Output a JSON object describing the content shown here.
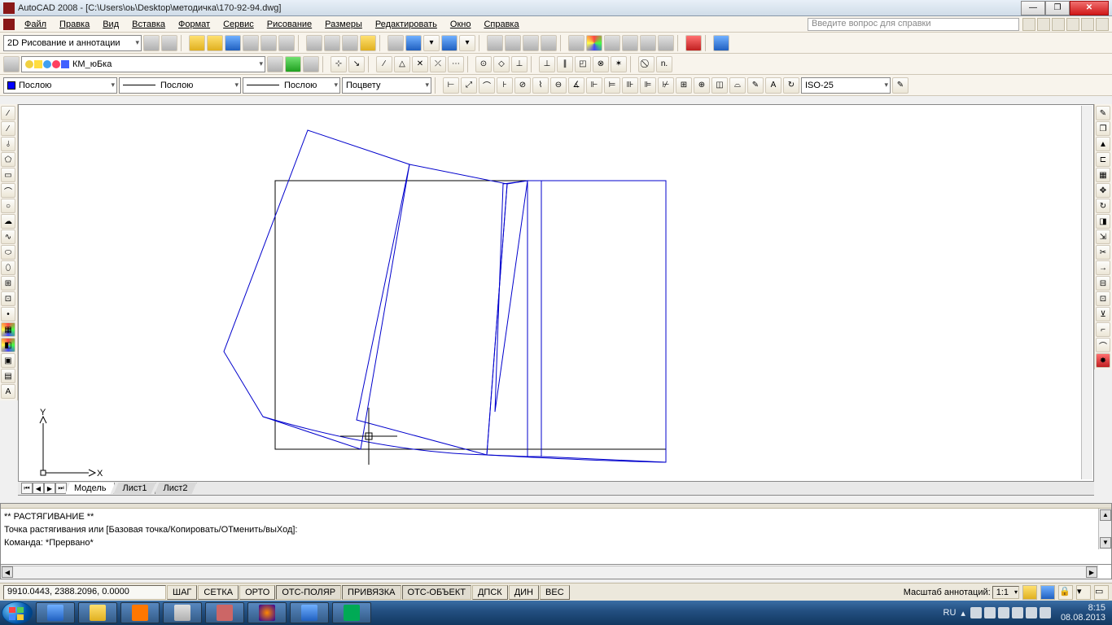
{
  "title": "AutoCAD 2008 - [C:\\Users\\оь\\Desktop\\методичка\\170-92-94.dwg]",
  "menu": [
    "Файл",
    "Правка",
    "Вид",
    "Вставка",
    "Формат",
    "Сервис",
    "Рисование",
    "Размеры",
    "Редактировать",
    "Окно",
    "Справка"
  ],
  "help_search_placeholder": "Введите вопрос для справки",
  "workspace_dropdown": "2D Рисование и аннотации",
  "layer_dropdown": "КМ_юБка",
  "color_dropdown": "Послою",
  "linetype_dropdown": "Послою",
  "lineweight_dropdown": "Послою",
  "plotstyle_dropdown": "Поцвету",
  "dimstyle_dropdown": "ISO-25",
  "layout_tabs": {
    "nav": [
      "⏮",
      "◀",
      "▶",
      "⏭"
    ],
    "items": [
      "Модель",
      "Лист1",
      "Лист2"
    ],
    "active": 0
  },
  "command_lines": [
    "** РАСТЯГИВАНИЕ **",
    "Точка растягивания или [Базовая точка/Копировать/ОТменить/выХод]:",
    "Команда: *Прервано*"
  ],
  "command_prompt": "Команда:",
  "status": {
    "coords": "9910.0443, 2388.2096, 0.0000",
    "modes": [
      {
        "label": "ШАГ",
        "on": false
      },
      {
        "label": "СЕТКА",
        "on": false
      },
      {
        "label": "ОРТО",
        "on": false
      },
      {
        "label": "ОТС-ПОЛЯР",
        "on": true
      },
      {
        "label": "ПРИВЯЗКА",
        "on": true
      },
      {
        "label": "ОТС-ОБЪЕКТ",
        "on": true
      },
      {
        "label": "ДПСК",
        "on": false
      },
      {
        "label": "ДИН",
        "on": false
      },
      {
        "label": "ВЕС",
        "on": false
      }
    ],
    "anno_label": "Масштаб аннотаций:",
    "anno_value": "1:1"
  },
  "tray": {
    "lang": "RU",
    "time": "8:15",
    "date": "08.08.2013"
  },
  "ucs": {
    "x": "X",
    "y": "Y"
  }
}
